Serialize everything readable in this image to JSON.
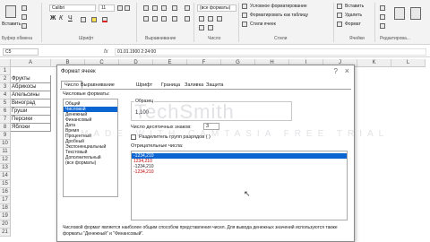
{
  "ribbon": {
    "paste_label": "Вставить",
    "font_name": "Calibri",
    "font_size": "11",
    "number_format": "(все форматы)",
    "styles": {
      "conditional": "Условное форматирование",
      "as_table": "Форматировать как таблицу",
      "cell_styles": "Стили ячеек"
    },
    "cells": {
      "insert": "Вставить",
      "delete": "Удалить",
      "format": "Формат"
    },
    "groups": {
      "clipboard": "Буфер обмена",
      "font": "Шрифт",
      "alignment": "Выравнивание",
      "number": "Число",
      "styles": "Стили",
      "cells": "Ячейки",
      "editing": "Редактирова..."
    }
  },
  "formula_bar": {
    "name_box": "C5",
    "formula": "01.01.1900  2:24:00"
  },
  "sheet": {
    "columns": [
      "A",
      "B",
      "C",
      "D",
      "E",
      "F",
      "G",
      "H",
      "I",
      "J",
      "K",
      "L"
    ],
    "rows": [
      "1",
      "2",
      "3",
      "4",
      "5",
      "6",
      "7",
      "8",
      "9",
      "10",
      "11",
      "12",
      "13",
      "14",
      "15",
      "16",
      "17",
      "18",
      "19",
      "20",
      "21"
    ],
    "column_a": [
      "Фрукты",
      "Абрикосы",
      "Апельсины",
      "Виноград",
      "Груши",
      "Персики",
      "Яблоки"
    ]
  },
  "dialog": {
    "title": "Формат ячеек",
    "tabs": [
      "Число",
      "Выравнивание",
      "Шрифт",
      "Граница",
      "Заливка",
      "Защита"
    ],
    "formats_label": "Числовые форматы:",
    "formats": [
      "Общий",
      "Числовой",
      "Денежный",
      "Финансовый",
      "Дата",
      "Время",
      "Процентный",
      "Дробный",
      "Экспоненциальный",
      "Текстовый",
      "Дополнительный",
      "(все форматы)"
    ],
    "selected_format": "Числовой",
    "sample_label": "Образец",
    "sample_value": "1,100",
    "decimals_label": "Число десятичных знаков:",
    "decimals_value": "3",
    "separator_label": "Разделитель групп разрядов ( )",
    "negatives_label": "Отрицательные числа:",
    "negatives": [
      "-1234,210",
      "1234,210",
      "-1234,210",
      "-1234,210"
    ],
    "negative_colors": [
      "#ffffff",
      "#c00000",
      "#222222",
      "#c00000"
    ],
    "description": "Числовой формат является наиболее общим способом представления чисел. Для вывода денежных значений используются также форматы \"Денежный\" и \"Финансовый\".",
    "watermark": "TechSmith",
    "watermark_sub": "MADE WITH CAMTASIA FREE TRIAL"
  }
}
